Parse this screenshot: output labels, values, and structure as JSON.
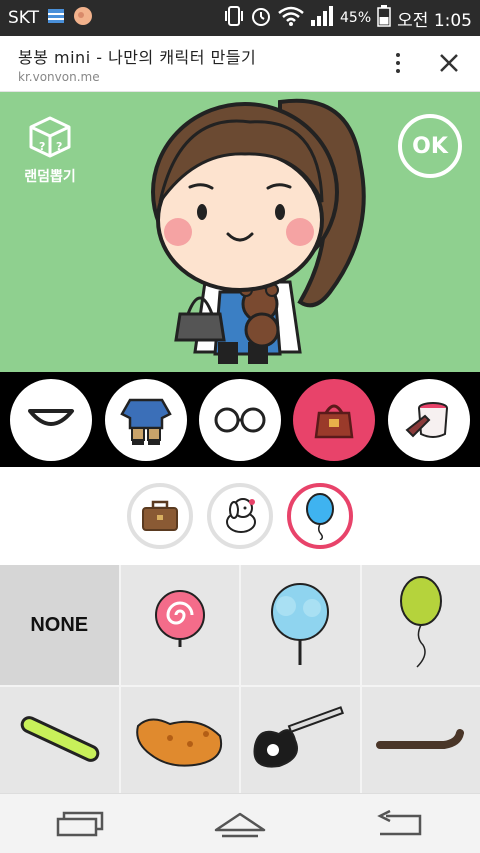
{
  "status": {
    "carrier": "SKT",
    "battery": "45%",
    "time": "오전 1:05"
  },
  "browser": {
    "title": "봉봉 mini - 나만의 캐릭터 만들기",
    "url": "kr.vonvon.me"
  },
  "stage": {
    "random_label": "랜덤뽑기",
    "ok_label": "OK",
    "bg_color": "#8fd08f"
  },
  "categories": [
    {
      "icon": "mouth-icon",
      "active": false
    },
    {
      "icon": "outfit-icon",
      "active": false
    },
    {
      "icon": "glasses-icon",
      "active": false
    },
    {
      "icon": "bag-icon",
      "active": true
    },
    {
      "icon": "paint-bucket-icon",
      "active": false
    }
  ],
  "subcategories": [
    {
      "icon": "briefcase-icon",
      "active": false
    },
    {
      "icon": "dog-icon",
      "active": false
    },
    {
      "icon": "balloon-icon",
      "active": true
    }
  ],
  "items": [
    {
      "icon": "none",
      "label": "NONE",
      "selected": true
    },
    {
      "icon": "lollipop-icon"
    },
    {
      "icon": "cotton-candy-icon"
    },
    {
      "icon": "green-balloon-icon"
    },
    {
      "icon": "glow-stick-icon"
    },
    {
      "icon": "fried-chicken-icon"
    },
    {
      "icon": "electric-guitar-icon"
    },
    {
      "icon": "cane-icon"
    }
  ],
  "colors": {
    "accent": "#e8436a",
    "stage_green": "#8fd08f"
  }
}
